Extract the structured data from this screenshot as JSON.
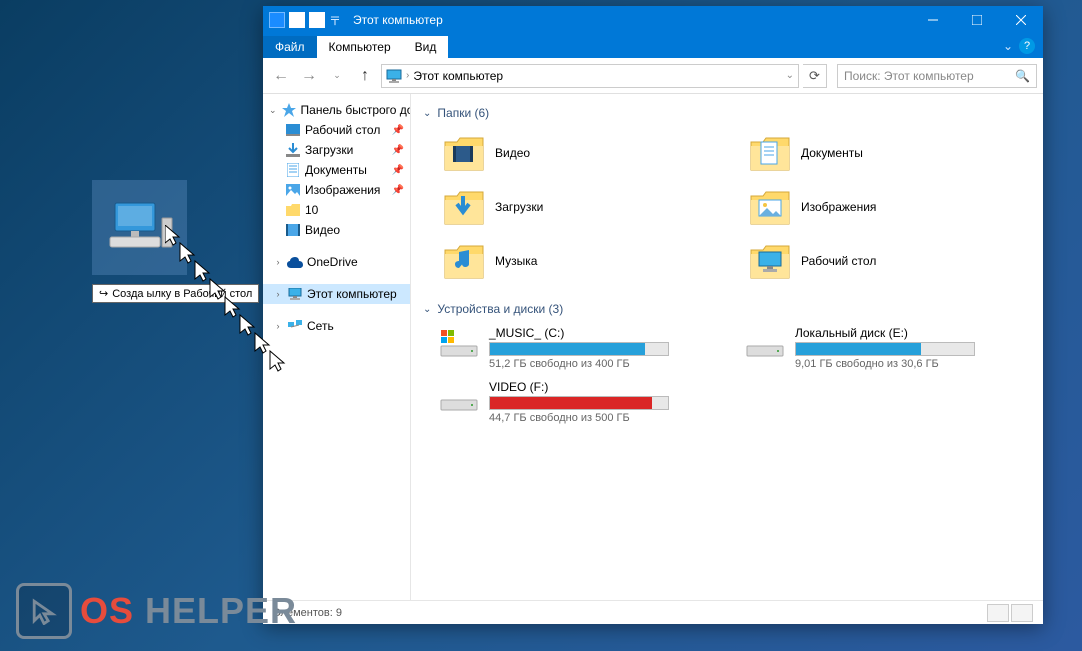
{
  "window": {
    "title": "Этот компьютер",
    "tabs": {
      "file": "Файл",
      "computer": "Компьютер",
      "view": "Вид"
    },
    "addressbar": {
      "location": "Этот компьютер"
    },
    "search": {
      "placeholder": "Поиск: Этот компьютер"
    }
  },
  "sidebar": {
    "quick_access": "Панель быстрого до",
    "items": [
      {
        "label": "Рабочий стол",
        "pinned": true
      },
      {
        "label": "Загрузки",
        "pinned": true
      },
      {
        "label": "Документы",
        "pinned": true
      },
      {
        "label": "Изображения",
        "pinned": true
      },
      {
        "label": "10",
        "pinned": false
      },
      {
        "label": "Видео",
        "pinned": false
      }
    ],
    "onedrive": "OneDrive",
    "this_pc": "Этот компьютер",
    "network": "Сеть"
  },
  "content": {
    "folders_header": "Папки (6)",
    "folders": [
      {
        "label": "Видео"
      },
      {
        "label": "Документы"
      },
      {
        "label": "Загрузки"
      },
      {
        "label": "Изображения"
      },
      {
        "label": "Музыка"
      },
      {
        "label": "Рабочий стол"
      }
    ],
    "drives_header": "Устройства и диски (3)",
    "drives": [
      {
        "name": "_MUSIC_ (C:)",
        "free_text": "51,2 ГБ свободно из 400 ГБ",
        "fill_pct": 87,
        "color": "#26a0da"
      },
      {
        "name": "Локальный диск (E:)",
        "free_text": "9,01 ГБ свободно из 30,6 ГБ",
        "fill_pct": 70,
        "color": "#26a0da"
      },
      {
        "name": "VIDEO (F:)",
        "free_text": "44,7 ГБ свободно из 500 ГБ",
        "fill_pct": 91,
        "color": "#da2626"
      }
    ]
  },
  "statusbar": {
    "text": "Элементов: 9"
  },
  "drag_tooltip": "Созда        ылку в Рабочий стол",
  "watermark": {
    "os": "OS",
    "helper": " HELPER"
  }
}
